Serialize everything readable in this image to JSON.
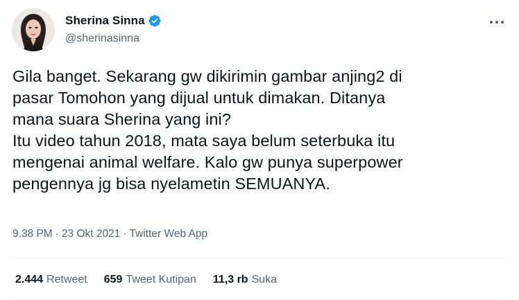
{
  "author": {
    "display_name": "Sherina Sinna",
    "handle": "@sherinasinna",
    "verified": true,
    "verified_color": "#1d9bf0"
  },
  "tweet": {
    "text": "Gila banget. Sekarang gw dikirimin gambar anjing2 di\npasar Tomohon yang dijual untuk dimakan. Ditanya\nmana suara Sherina yang ini?\nItu video tahun 2018, mata saya belum seterbuka itu\nmengenai animal welfare. Kalo gw punya superpower\npengennya jg bisa nyelametin SEMUANYA."
  },
  "meta": {
    "time": "9.38 PM",
    "separator1": "·",
    "date": "23 Okt 2021",
    "separator2": "·",
    "source": "Twitter Web App"
  },
  "stats": {
    "retweets": {
      "count": "2.444",
      "label": "Retweet"
    },
    "quotes": {
      "count": "659",
      "label": "Tweet Kutipan"
    },
    "likes": {
      "count": "11,3 rb",
      "label": "Suka"
    }
  },
  "icons": {
    "more": "more-horizontal-icon",
    "verified": "verified-badge-icon"
  }
}
